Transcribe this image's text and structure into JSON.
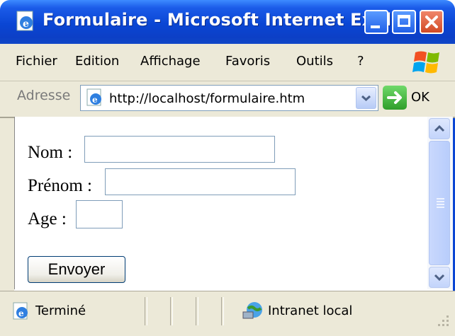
{
  "window": {
    "title": "Formulaire - Microsoft Internet Expl...",
    "title_bar_color": "#0a46d4",
    "close_button_color": "#d24a25"
  },
  "menu": {
    "items": [
      "Fichier",
      "Edition",
      "Affichage",
      "Favoris",
      "Outils",
      "?"
    ]
  },
  "address_bar": {
    "label": "Adresse",
    "url": "http://localhost/formulaire.htm",
    "go_label": "OK"
  },
  "form": {
    "nom_label": "Nom :",
    "prenom_label": "Prénom :",
    "age_label": "Age :",
    "nom_value": "",
    "prenom_value": "",
    "age_value": "",
    "submit_label": "Envoyer"
  },
  "status_bar": {
    "status_text": "Terminé",
    "zone_text": "Intranet local"
  },
  "icons": {
    "page_icon": "ie-page-icon",
    "windows_logo": "windows-logo-icon",
    "go": "go-arrow-icon",
    "intranet": "intranet-globe-icon"
  }
}
